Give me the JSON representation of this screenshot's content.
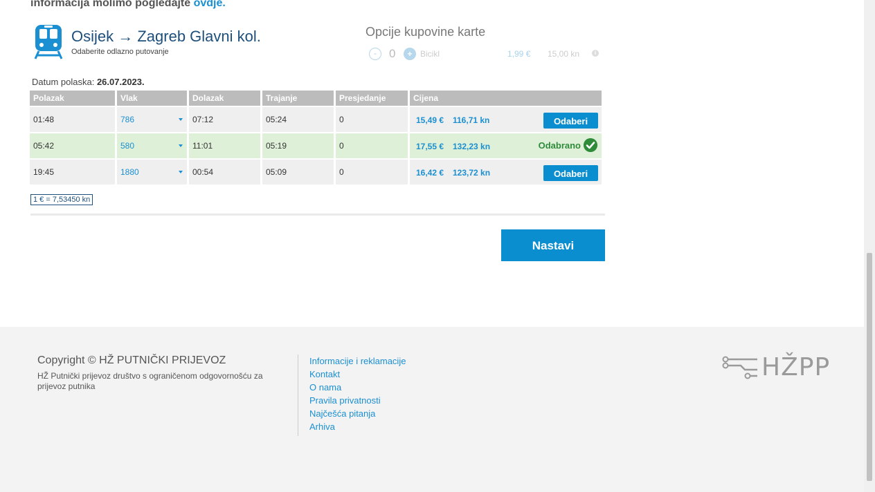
{
  "notice": {
    "text": "informacija molimo pogledajte",
    "link_label": "ovdje."
  },
  "route": {
    "title": "Osijek → Zagreb Glavni kol.",
    "subtitle": "Odaberite odlazno putovanje",
    "icon": "train-icon"
  },
  "options": {
    "title": "Opcije kupovine karte",
    "quantity": "0",
    "minus_label": "-",
    "plus_label": "+",
    "item_label": "Bicikl",
    "price_eur": "1,99 €",
    "price_kn": "15,00 kn",
    "info_label": "i"
  },
  "departure": {
    "label": "Datum polaska:",
    "date": "26.07.2023."
  },
  "table": {
    "headers": [
      "Polazak",
      "Vlak",
      "Dolazak",
      "Trajanje",
      "Presjedanje",
      "Cijena"
    ],
    "rows": [
      {
        "departure": "01:48",
        "train": "786",
        "arrival": "07:12",
        "duration": "05:24",
        "transfers": "0",
        "price_eur": "15,49 €",
        "price_kn": "116,71 kn",
        "action": "Odaberi",
        "selected": false
      },
      {
        "departure": "05:42",
        "train": "580",
        "arrival": "11:01",
        "duration": "05:19",
        "transfers": "0",
        "price_eur": "17,55 €",
        "price_kn": "132,23 kn",
        "action": "Odabrano",
        "selected": true
      },
      {
        "departure": "19:45",
        "train": "1880",
        "arrival": "00:54",
        "duration": "05:09",
        "transfers": "0",
        "price_eur": "16,42 €",
        "price_kn": "123,72 kn",
        "action": "Odaberi",
        "selected": false
      }
    ]
  },
  "exchange_rate": "1 € = 7,53450 kn",
  "continue_label": "Nastavi",
  "footer": {
    "copyright": "Copyright © HŽ PUTNIČKI PRIJEVOZ",
    "company": "HŽ Putnički prijevoz društvo s ograničenom odgovornošću za prijevoz putnika",
    "links": [
      "Informacije i reklamacije",
      "Kontakt",
      "O nama",
      "Pravila privatnosti",
      "Najčešća pitanja",
      "Arhiva"
    ],
    "logo_text": "HŽPP"
  },
  "colors": {
    "accent": "#0b8ecf",
    "title": "#1d4f7c",
    "selected_row": "#dff0d8",
    "success": "#2e8b3a",
    "header_gray": "#bcbcbc"
  }
}
